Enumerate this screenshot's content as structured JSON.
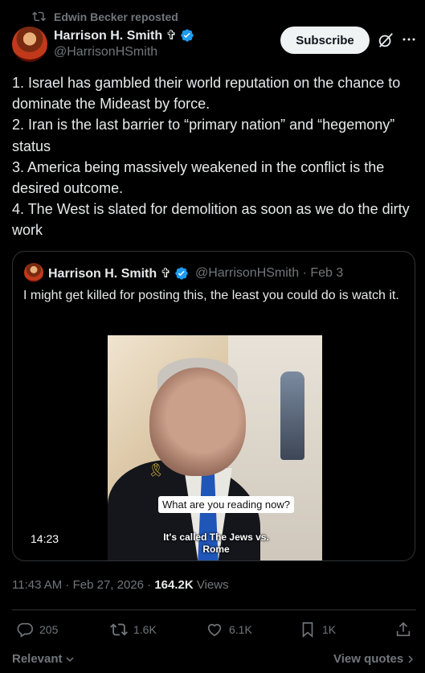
{
  "repost": {
    "text": "Edwin Becker reposted",
    "icon": "repost-icon"
  },
  "author": {
    "name": "Harrison H. Smith ✞",
    "handle": "@HarrisonHSmith",
    "verified_color": "#1d9bf0"
  },
  "header_actions": {
    "subscribe_label": "Subscribe",
    "grok_icon": "grok-icon",
    "more_icon": "more-icon"
  },
  "tweet": {
    "text": "1. Israel has gambled their world reputation on the chance to dominate the Mideast by force.\n2. Iran is the last barrier to “primary nation” and “hegemony” status\n3. America being massively weakened in the conflict is the desired outcome.\n4. The West is slated for demolition as soon as we do the dirty work"
  },
  "quote": {
    "name": "Harrison H. Smith ✞",
    "handle": "@HarrisonHSmith · Feb 3",
    "text": "I might get killed for posting this, the least you could do is watch it.",
    "video": {
      "duration": "14:23",
      "caption_question": "What are you reading now?",
      "caption_answer": "It's called The Jews vs. Rome"
    }
  },
  "meta": {
    "time_date": "11:43 AM · Feb 27, 2026 · ",
    "views_count": "164.2K",
    "views_label": " Views"
  },
  "actions": {
    "replies": "205",
    "reposts": "1.6K",
    "likes": "6.1K",
    "bookmarks": "1K"
  },
  "footer": {
    "sort_label": "Relevant",
    "view_quotes_label": "View quotes"
  },
  "colors": {
    "background": "#000000",
    "text": "#e7e9ea",
    "muted": "#71767b",
    "accent": "#1d9bf0",
    "border": "#2f3336"
  }
}
